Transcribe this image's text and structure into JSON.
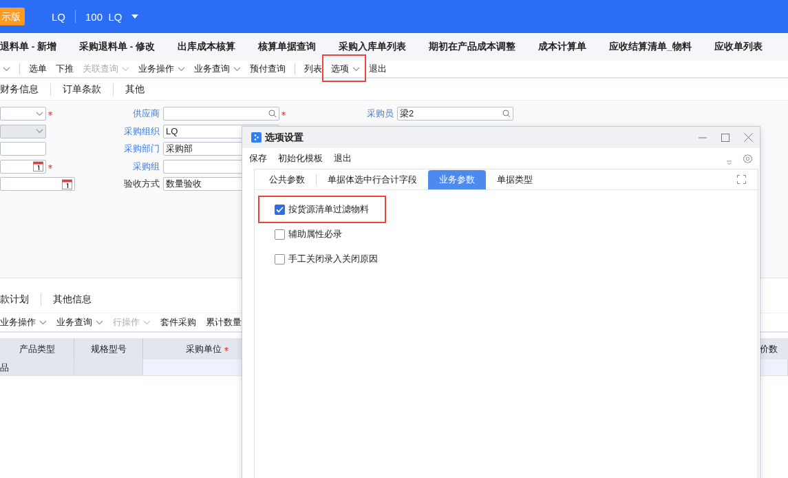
{
  "top_bar": {
    "badge": "示版",
    "org": "LQ",
    "account": "100  LQ"
  },
  "page_tabs": [
    "退料单 - 新增",
    "采购退料单 - 修改",
    "出库成本核算",
    "核算单据查询",
    "采购入库单列表",
    "期初在产品成本调整",
    "成本计算单",
    "应收结算清单_物料",
    "应收单列表"
  ],
  "toolbar": [
    {
      "kind": "chevron"
    },
    {
      "kind": "divider"
    },
    {
      "kind": "button",
      "label": "选单",
      "disabled": false,
      "highlighted": false
    },
    {
      "kind": "button",
      "label": "下推",
      "disabled": false,
      "highlighted": false
    },
    {
      "kind": "dropdown",
      "label": "关联查询",
      "disabled": true,
      "highlighted": false
    },
    {
      "kind": "dropdown",
      "label": "业务操作",
      "disabled": false,
      "highlighted": false
    },
    {
      "kind": "dropdown",
      "label": "业务查询",
      "disabled": false,
      "highlighted": false
    },
    {
      "kind": "button",
      "label": "预付查询",
      "disabled": false,
      "highlighted": false
    },
    {
      "kind": "divider"
    },
    {
      "kind": "button",
      "label": "列表",
      "disabled": false,
      "highlighted": false
    },
    {
      "kind": "dropdown",
      "label": "选项",
      "disabled": false,
      "highlighted": true
    },
    {
      "kind": "button",
      "label": "退出",
      "disabled": false,
      "highlighted": false
    }
  ],
  "header_tabs": [
    "财务信息",
    "订单条款",
    "其他"
  ],
  "form": {
    "column_1": [
      {
        "kind": "select",
        "disabled": false,
        "required": true,
        "wide": false
      },
      {
        "kind": "select",
        "disabled": true,
        "required": false,
        "wide": false
      },
      {
        "kind": "text",
        "disabled": false,
        "required": false,
        "wide": false
      },
      {
        "kind": "date",
        "disabled": false,
        "required": true,
        "wide": false
      },
      {
        "kind": "date",
        "disabled": false,
        "required": false,
        "wide": true
      }
    ],
    "column_2": [
      {
        "label": "供应商",
        "kind": "lookup",
        "required": true,
        "linked": true
      },
      {
        "label": "采购组织",
        "kind": "text",
        "value": "LQ",
        "linked": true
      },
      {
        "label": "采购部门",
        "kind": "text",
        "value": "采购部",
        "linked": true
      },
      {
        "label": "采购组",
        "kind": "text",
        "linked": true
      },
      {
        "label": "验收方式",
        "kind": "text",
        "value": "数量验收",
        "linked": false
      }
    ],
    "column_3": [
      {
        "label": "采购员",
        "kind": "lookup",
        "value": "梁2",
        "required": false,
        "linked": true
      }
    ]
  },
  "detail_tabs": [
    "款计划",
    "其他信息"
  ],
  "detail_toolbar": [
    {
      "kind": "dropdown",
      "label": "业务操作",
      "disabled": false
    },
    {
      "kind": "dropdown",
      "label": "业务查询",
      "disabled": false
    },
    {
      "kind": "dropdown",
      "label": "行操作",
      "disabled": true
    },
    {
      "kind": "button",
      "label": "套件采购",
      "disabled": false
    },
    {
      "kind": "button",
      "label": "累计数量",
      "disabled": false
    }
  ],
  "grid": {
    "columns": [
      {
        "label": "产品类型",
        "required": false
      },
      {
        "label": "规格型号",
        "required": false
      },
      {
        "label": "采购单位",
        "required": true
      }
    ],
    "right_column": "价数",
    "rows": [
      [
        "品",
        null,
        null
      ]
    ]
  },
  "dialog": {
    "title": "选项设置",
    "menu": [
      "保存",
      "初始化模板",
      "退出"
    ],
    "tabs": [
      {
        "label": "公共参数",
        "selected": false
      },
      {
        "label": "单据体选中行合计字段",
        "selected": false
      },
      {
        "label": "业务参数",
        "selected": true
      },
      {
        "label": "单据类型",
        "selected": false
      }
    ],
    "options": [
      {
        "label": "按货源清单过滤物料",
        "checked": true,
        "highlighted": true
      },
      {
        "label": "辅助属性必录",
        "checked": false,
        "highlighted": false
      },
      {
        "label": "手工关闭录入关闭原因",
        "checked": false,
        "highlighted": false
      }
    ]
  }
}
